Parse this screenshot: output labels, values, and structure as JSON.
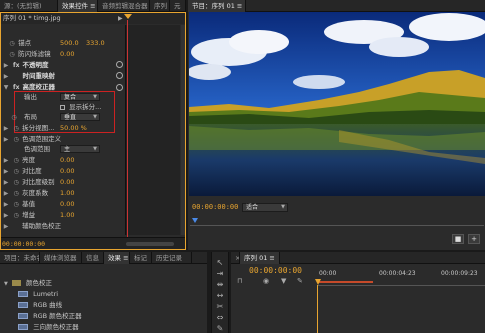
{
  "effect_controls": {
    "tabs": [
      {
        "label": "源：(无剪辑)"
      },
      {
        "label": "效果控件 ≡"
      },
      {
        "label": "音频剪辑混合器"
      },
      {
        "label": "序列"
      },
      {
        "label": "元"
      }
    ],
    "clip_name": "序列 01 * timg.jpg",
    "anchor_label": "锚点",
    "anchor_x": "500.0",
    "anchor_y": "333.0",
    "flicker_label": "防闪烁滤镜",
    "flicker_val": "0.00",
    "opacity_label": "不透明度",
    "timeremap_label": "时间重映射",
    "fx_label": "高度校正器",
    "output_label": "输出",
    "output_val": "复合",
    "show_split": "显示拆分...",
    "layout_label": "布局",
    "layout_val": "垂直",
    "split_label": "拆分视图...",
    "split_val": "50.00 %",
    "tonal_label": "色调范围定义",
    "tonal_range_label": "色调范围",
    "tonal_range_val": "主",
    "brightness_label": "亮度",
    "brightness_val": "0.00",
    "contrast_label": "对比度",
    "contrast_val": "0.00",
    "contrast_level_label": "对比度级别",
    "contrast_level_val": "0.00",
    "gamma_label": "灰度系数",
    "gamma_val": "1.00",
    "pedestal_label": "基值",
    "pedestal_val": "0.00",
    "gain_label": "增益",
    "gain_val": "1.00",
    "secondary_label": "辅助颜色校正",
    "timecode": "00:00:00:00"
  },
  "program": {
    "tab_label": "节目：序列 01 ≡",
    "timecode": "00:00:00:00",
    "fit_label": "适合"
  },
  "effects_panel": {
    "tabs": [
      {
        "label": "项目：未命名"
      },
      {
        "label": "媒体浏览器"
      },
      {
        "label": "信息"
      },
      {
        "label": "效果 ≡"
      },
      {
        "label": "标记"
      },
      {
        "label": "历史记录"
      }
    ],
    "folder": "颜色校正",
    "items": [
      {
        "label": "Lumetri"
      },
      {
        "label": "RGB 曲线"
      },
      {
        "label": "RGB 颜色校正器"
      },
      {
        "label": "三向颜色校正器"
      }
    ]
  },
  "timeline": {
    "tab_label": "序列 01 ≡",
    "timecode": "00:00:00:00",
    "ruler": [
      {
        "label": "00:00"
      },
      {
        "label": "00:00:04:23"
      },
      {
        "label": "00:00:09:23"
      }
    ]
  },
  "icons": {
    "close": "close-icon",
    "reset": "reset-icon",
    "fx": "fx-icon",
    "stopwatch": "stopwatch-icon",
    "play": "play-icon",
    "folder": "folder-icon",
    "wrench": "wrench-icon"
  },
  "colors": {
    "accent": "#e8a530",
    "highlight_box": "#cc2222",
    "playhead": "#cc3333",
    "timeline_playhead": "#e8a530"
  }
}
